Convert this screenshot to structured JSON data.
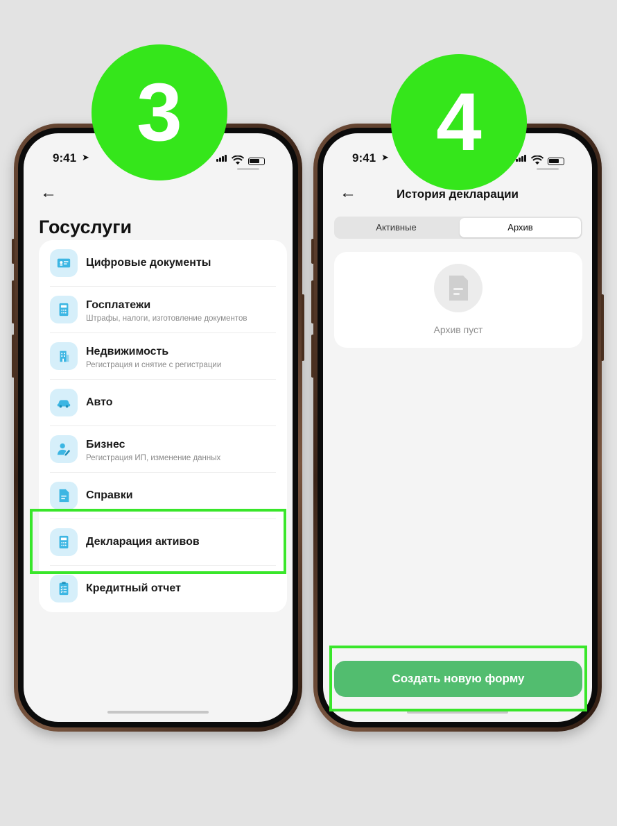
{
  "badges": {
    "left": "3",
    "right": "4"
  },
  "status": {
    "time": "9:41"
  },
  "left": {
    "title": "Госуслуги",
    "items": [
      {
        "label": "Цифровые документы",
        "subtitle": "",
        "icon": "id-card-icon"
      },
      {
        "label": "Госплатежи",
        "subtitle": "Штрафы, налоги, изготовление документов",
        "icon": "calculator-icon"
      },
      {
        "label": "Недвижимость",
        "subtitle": "Регистрация и снятие с регистрации",
        "icon": "building-icon"
      },
      {
        "label": "Авто",
        "subtitle": "",
        "icon": "car-icon"
      },
      {
        "label": "Бизнес",
        "subtitle": "Регистрация ИП, изменение данных",
        "icon": "person-edit-icon"
      },
      {
        "label": "Справки",
        "subtitle": "",
        "icon": "document-icon"
      },
      {
        "label": "Декларация активов",
        "subtitle": "",
        "icon": "calculator-icon"
      },
      {
        "label": "Кредитный отчет",
        "subtitle": "",
        "icon": "checklist-icon"
      }
    ]
  },
  "right": {
    "title": "История декларации",
    "tabs": [
      "Активные",
      "Архив"
    ],
    "active_tab": "Архив",
    "empty_text": "Архив пуст",
    "create_button": "Создать новую форму"
  },
  "colors": {
    "highlight": "#39e62a",
    "badge": "#35e61b",
    "primary_button": "#52bd6f",
    "icon_bg": "#d6effa",
    "icon_fg": "#3cb6e3"
  }
}
